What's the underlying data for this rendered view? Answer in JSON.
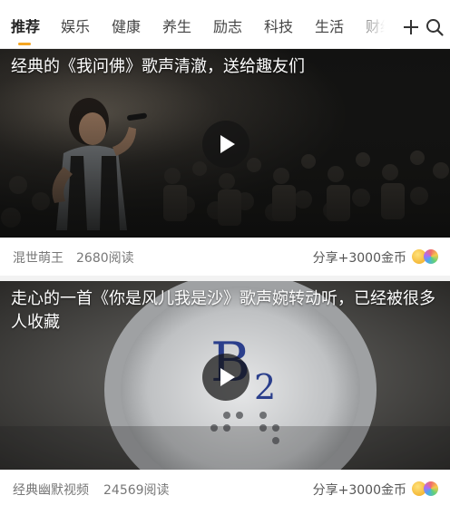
{
  "tabs": [
    {
      "label": "推荐",
      "active": true
    },
    {
      "label": "娱乐",
      "active": false
    },
    {
      "label": "健康",
      "active": false
    },
    {
      "label": "养生",
      "active": false
    },
    {
      "label": "励志",
      "active": false
    },
    {
      "label": "科技",
      "active": false
    },
    {
      "label": "生活",
      "active": false
    },
    {
      "label": "财经",
      "active": false
    }
  ],
  "toolbar": {
    "add_icon": "plus-icon",
    "search_icon": "search-icon"
  },
  "accent_color": "#f5a623",
  "feed": [
    {
      "title": "经典的《我问佛》歌声清澈，送给趣友们",
      "author": "混世萌王",
      "reads": "2680阅读",
      "share_reward": "分享+3000金币",
      "play_icon": "play-icon"
    },
    {
      "title": "走心的一首《你是风儿我是沙》歌声婉转动听，已经被很多人收藏",
      "author": "经典幽默视频",
      "reads": "24569阅读",
      "share_reward": "分享+3000金币",
      "play_icon": "play-icon"
    }
  ]
}
